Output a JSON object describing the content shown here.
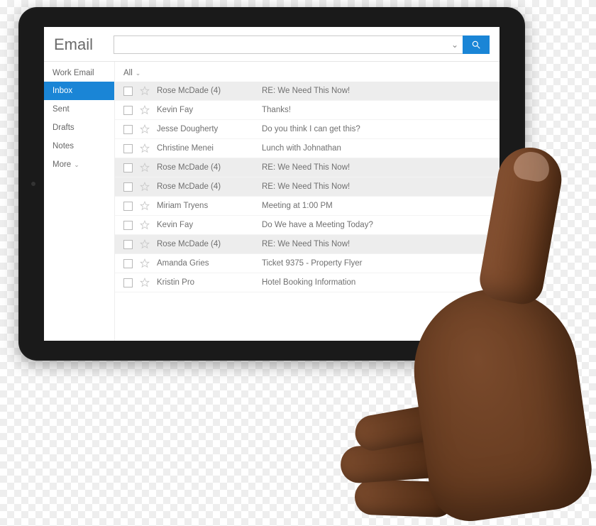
{
  "header": {
    "title": "Email",
    "search_value": "",
    "search_placeholder": ""
  },
  "sidebar": {
    "account": "Work Email",
    "items": [
      {
        "label": "Inbox",
        "active": true,
        "caret": false
      },
      {
        "label": "Sent",
        "active": false,
        "caret": false
      },
      {
        "label": "Drafts",
        "active": false,
        "caret": false
      },
      {
        "label": "Notes",
        "active": false,
        "caret": false
      },
      {
        "label": "More",
        "active": false,
        "caret": true
      }
    ]
  },
  "filter": {
    "label": "All"
  },
  "messages": [
    {
      "sender": "Rose McDade (4)",
      "subject": "RE: We Need This Now!",
      "hl": true
    },
    {
      "sender": "Kevin Fay",
      "subject": "Thanks!",
      "hl": false
    },
    {
      "sender": "Jesse Dougherty",
      "subject": "Do you think I can get this?",
      "hl": false
    },
    {
      "sender": "Christine Menei",
      "subject": "Lunch with Johnathan",
      "hl": false
    },
    {
      "sender": "Rose McDade (4)",
      "subject": "RE: We Need This Now!",
      "hl": true
    },
    {
      "sender": "Rose McDade (4)",
      "subject": "RE: We Need This Now!",
      "hl": true
    },
    {
      "sender": "Miriam Tryens",
      "subject": "Meeting at 1:00 PM",
      "hl": false
    },
    {
      "sender": "Kevin Fay",
      "subject": "Do We have a Meeting Today?",
      "hl": false
    },
    {
      "sender": "Rose McDade (4)",
      "subject": "RE: We Need This Now!",
      "hl": true
    },
    {
      "sender": "Amanda Gries",
      "subject": "Ticket 9375 - Property Flyer",
      "hl": false
    },
    {
      "sender": "Kristin Pro",
      "subject": "Hotel Booking Information",
      "hl": false
    }
  ],
  "colors": {
    "accent": "#1a85d6"
  }
}
